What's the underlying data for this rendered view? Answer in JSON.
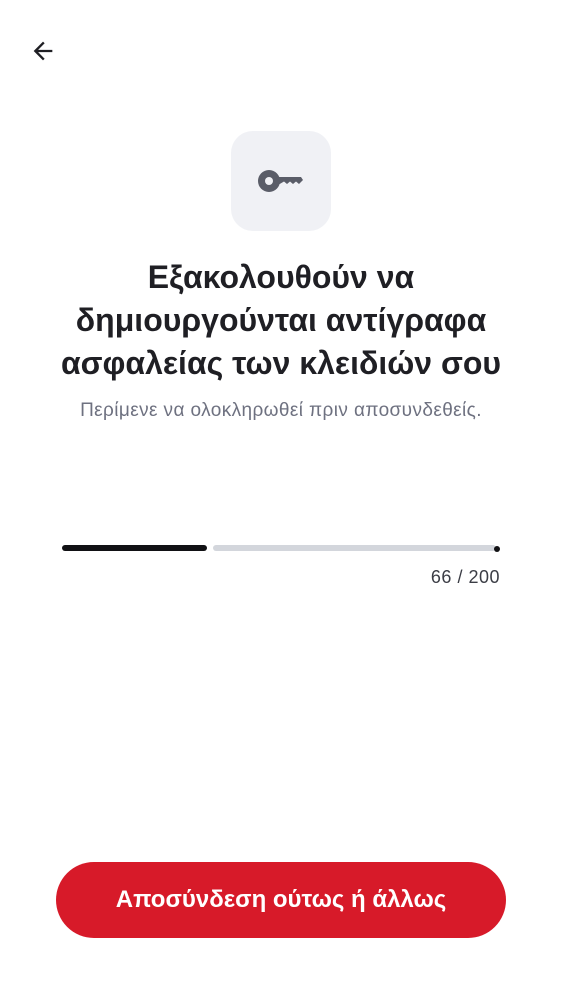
{
  "header": {
    "back_icon": "arrow-left-icon"
  },
  "hero": {
    "icon": "key-icon",
    "title": "Εξακολουθούν να δημιουργούνται αντίγραφα ασφαλείας των κλειδιών σου",
    "subtitle": "Περίμενε να ολοκληρωθεί πριν αποσυνδεθείς."
  },
  "progress": {
    "current": 66,
    "total": 200,
    "current_text": "66",
    "separator": " / ",
    "total_text": "200"
  },
  "actions": {
    "signout_label": "Αποσύνδεση ούτως ή άλλως"
  },
  "colors": {
    "accent": "#d71a29",
    "progress_fill": "#111114",
    "progress_track": "#d3d6dc",
    "icon_tile": "#f0f1f5"
  }
}
